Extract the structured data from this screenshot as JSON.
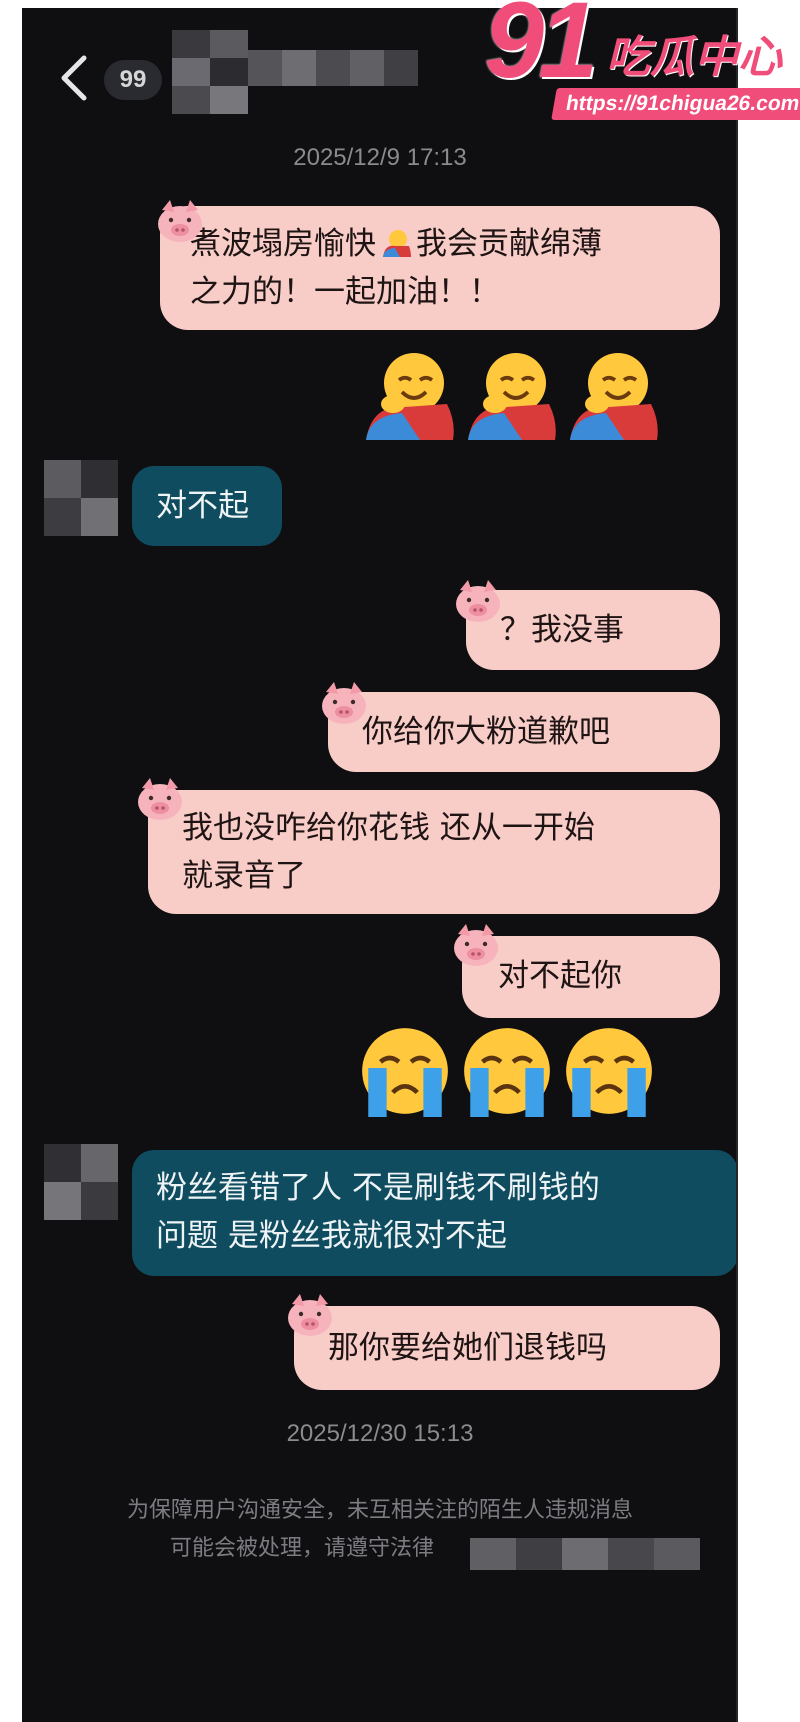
{
  "header": {
    "unread_count": "99"
  },
  "watermark": {
    "number": "91",
    "brand": "吃瓜中心",
    "url": "https://91chigua26.com"
  },
  "timestamps": [
    "2025/12/9 17:13",
    "2025/12/30 15:13"
  ],
  "messages": [
    {
      "from": "me",
      "text_line1": "煮波塌房愉快",
      "text_line1b": "我会贡献绵薄",
      "text_line2": "之力的！一起加油！！",
      "emoji": "hugging-face"
    },
    {
      "from": "me",
      "emoji_row": [
        "hugging-face",
        "hugging-face",
        "hugging-face"
      ]
    },
    {
      "from": "them",
      "text": "对不起"
    },
    {
      "from": "me",
      "text": "？我没事"
    },
    {
      "from": "me",
      "text": "你给你大粉道歉吧"
    },
    {
      "from": "me",
      "text_line1": "我也没咋给你花钱 还从一开始",
      "text_line2": "就录音了"
    },
    {
      "from": "me",
      "text": "对不起你"
    },
    {
      "from": "me",
      "emoji_row": [
        "loudly-crying-face",
        "loudly-crying-face",
        "loudly-crying-face"
      ]
    },
    {
      "from": "them",
      "text_line1": "粉丝看错了人  不是刷钱不刷钱的",
      "text_line2": "问题 是粉丝我就很对不起"
    },
    {
      "from": "me",
      "text": "那你要给她们退钱吗"
    }
  ],
  "notice": {
    "line1": "为保障用户沟通安全，未互相关注的陌生人违规消息",
    "line2": "可能会被处理，请遵守法律"
  }
}
